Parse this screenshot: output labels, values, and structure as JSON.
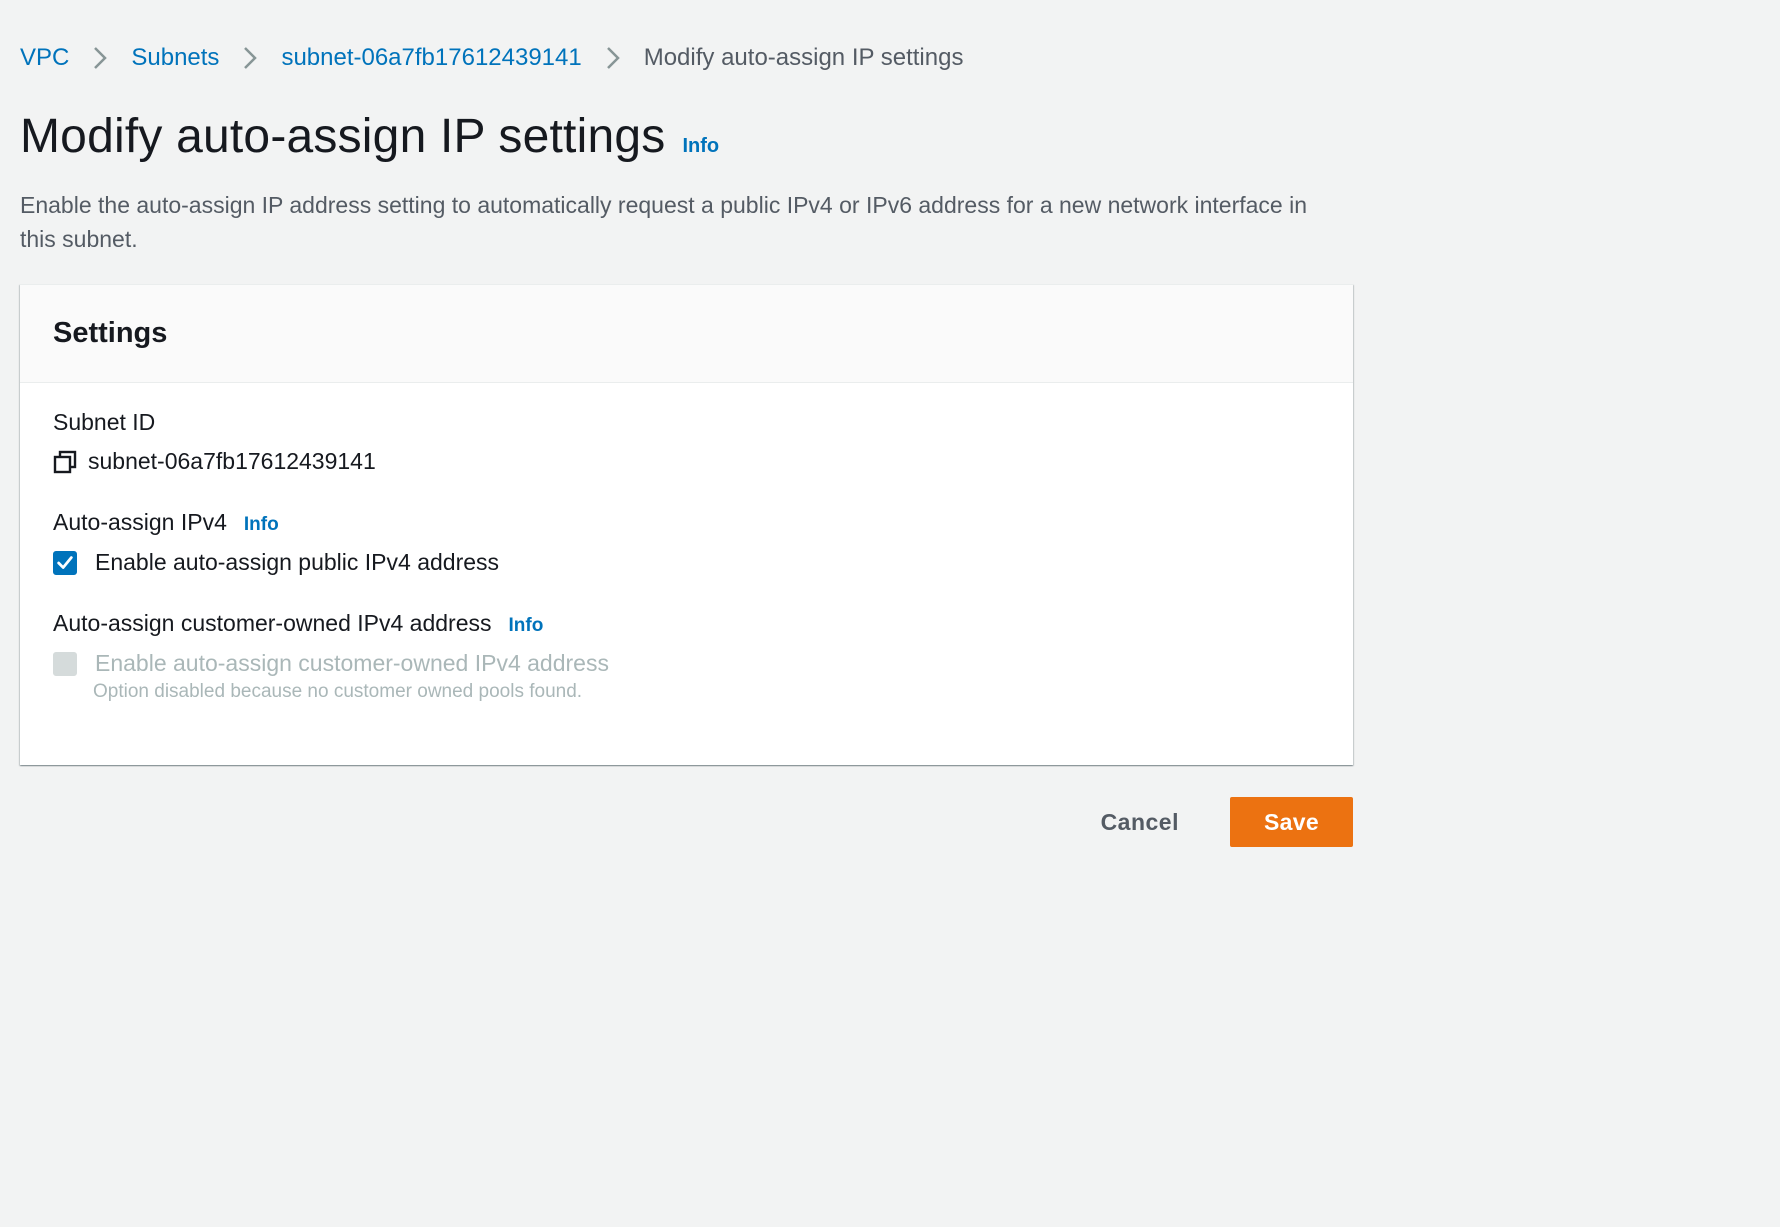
{
  "breadcrumb": {
    "items": [
      {
        "label": "VPC"
      },
      {
        "label": "Subnets"
      },
      {
        "label": "subnet-06a7fb17612439141"
      },
      {
        "label": "Modify auto-assign IP settings"
      }
    ]
  },
  "header": {
    "title": "Modify auto-assign IP settings",
    "info_label": "Info",
    "description": "Enable the auto-assign IP address setting to automatically request a public IPv4 or IPv6 address for a new network interface in this subnet."
  },
  "settings": {
    "title": "Settings",
    "subnet_id": {
      "label": "Subnet ID",
      "value": "subnet-06a7fb17612439141",
      "icon": "copy-icon"
    },
    "auto_assign_ipv4": {
      "label": "Auto-assign IPv4",
      "info_label": "Info",
      "checkbox_label": "Enable auto-assign public IPv4 address",
      "checked": true
    },
    "customer_owned_ipv4": {
      "label": "Auto-assign customer-owned IPv4 address",
      "info_label": "Info",
      "checkbox_label": "Enable auto-assign customer-owned IPv4 address",
      "description": "Option disabled because no customer owned pools found.",
      "checked": false,
      "disabled": true
    }
  },
  "actions": {
    "cancel_label": "Cancel",
    "save_label": "Save"
  },
  "colors": {
    "link": "#0073bb",
    "primary_button": "#ec7211",
    "background": "#f2f3f3"
  }
}
